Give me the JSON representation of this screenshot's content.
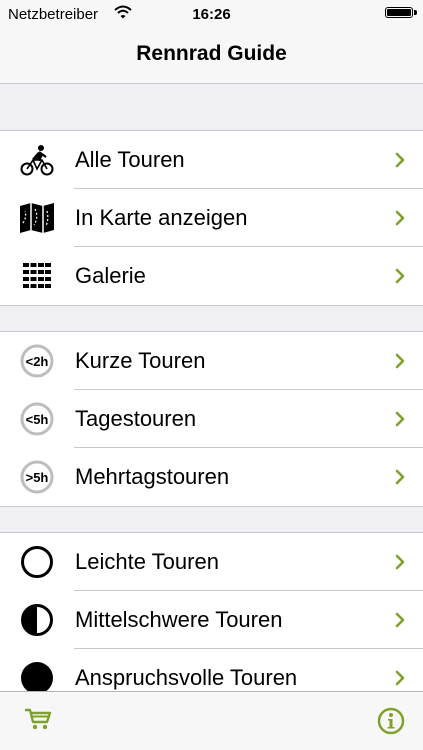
{
  "status_bar": {
    "carrier": "Netzbetreiber",
    "time": "16:26"
  },
  "nav": {
    "title": "Rennrad Guide"
  },
  "colors": {
    "chevron": "#7fa02a",
    "separator": "#c8c7cc",
    "group_bg": "#efeff4"
  },
  "sections": [
    [
      {
        "label": "Alle Touren",
        "icon": "cyclist-icon"
      },
      {
        "label": "In Karte anzeigen",
        "icon": "map-icon"
      },
      {
        "label": "Galerie",
        "icon": "gallery-grid-icon"
      }
    ],
    [
      {
        "label": "Kurze Touren",
        "icon": "duration-short-icon",
        "badge": "<2h"
      },
      {
        "label": "Tagestouren",
        "icon": "duration-day-icon",
        "badge": "<5h"
      },
      {
        "label": "Mehrtagstouren",
        "icon": "duration-multi-icon",
        "badge": ">5h"
      }
    ],
    [
      {
        "label": "Leichte Touren",
        "icon": "difficulty-easy-icon"
      },
      {
        "label": "Mittelschwere Touren",
        "icon": "difficulty-medium-icon"
      },
      {
        "label": "Anspruchsvolle Touren",
        "icon": "difficulty-hard-icon"
      }
    ]
  ],
  "tab_bar": {
    "left_icon": "cart-icon",
    "right_icon": "info-icon"
  }
}
